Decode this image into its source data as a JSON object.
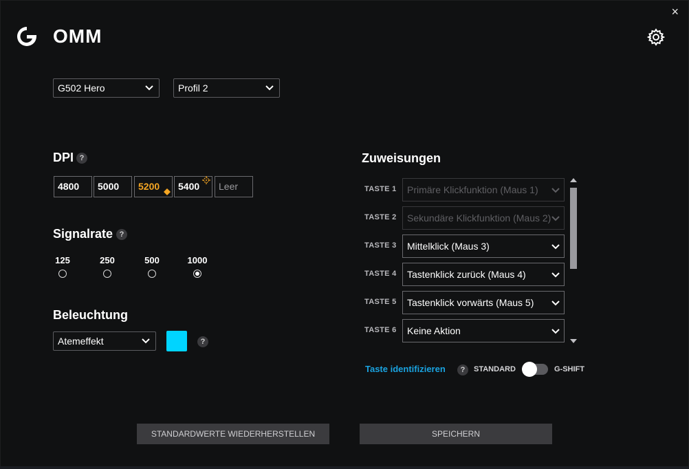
{
  "app": {
    "title": "OMM",
    "close_label": "×"
  },
  "device_select": {
    "value": "G502 Hero"
  },
  "profile_select": {
    "value": "Profil 2"
  },
  "dpi": {
    "title": "DPI",
    "help": "?",
    "values": [
      "4800",
      "5000",
      "5200",
      "5400",
      "Leer"
    ],
    "active_index": 2
  },
  "signal_rate": {
    "title": "Signalrate",
    "help": "?",
    "options": [
      "125",
      "250",
      "500",
      "1000"
    ],
    "selected": "1000"
  },
  "lighting": {
    "title": "Beleuchtung",
    "effect": "Atemeffekt",
    "help": "?",
    "color": "#00d4ff"
  },
  "assignments": {
    "title": "Zuweisungen",
    "rows": [
      {
        "key": "TASTE 1",
        "action": "Primäre Klickfunktion (Maus 1)",
        "disabled": true
      },
      {
        "key": "TASTE 2",
        "action": "Sekundäre Klickfunktion (Maus 2)",
        "disabled": true
      },
      {
        "key": "TASTE 3",
        "action": "Mittelklick (Maus 3)",
        "disabled": false
      },
      {
        "key": "TASTE 4",
        "action": "Tastenklick zurück (Maus 4)",
        "disabled": false
      },
      {
        "key": "TASTE 5",
        "action": "Tastenklick vorwärts (Maus 5)",
        "disabled": false
      },
      {
        "key": "TASTE 6",
        "action": "Keine Aktion",
        "disabled": false
      }
    ],
    "identify_link": "Taste identifizieren",
    "help": "?",
    "mode_standard": "STANDARD",
    "mode_gshift": "G-SHIFT",
    "gshift_enabled": false
  },
  "buttons": {
    "reset": "STANDARDWERTE WIEDERHERSTELLEN",
    "save": "SPEICHERN"
  },
  "colors": {
    "accent_orange": "#f5a623",
    "link_blue": "#1aa3e0",
    "swatch": "#00d4ff"
  }
}
